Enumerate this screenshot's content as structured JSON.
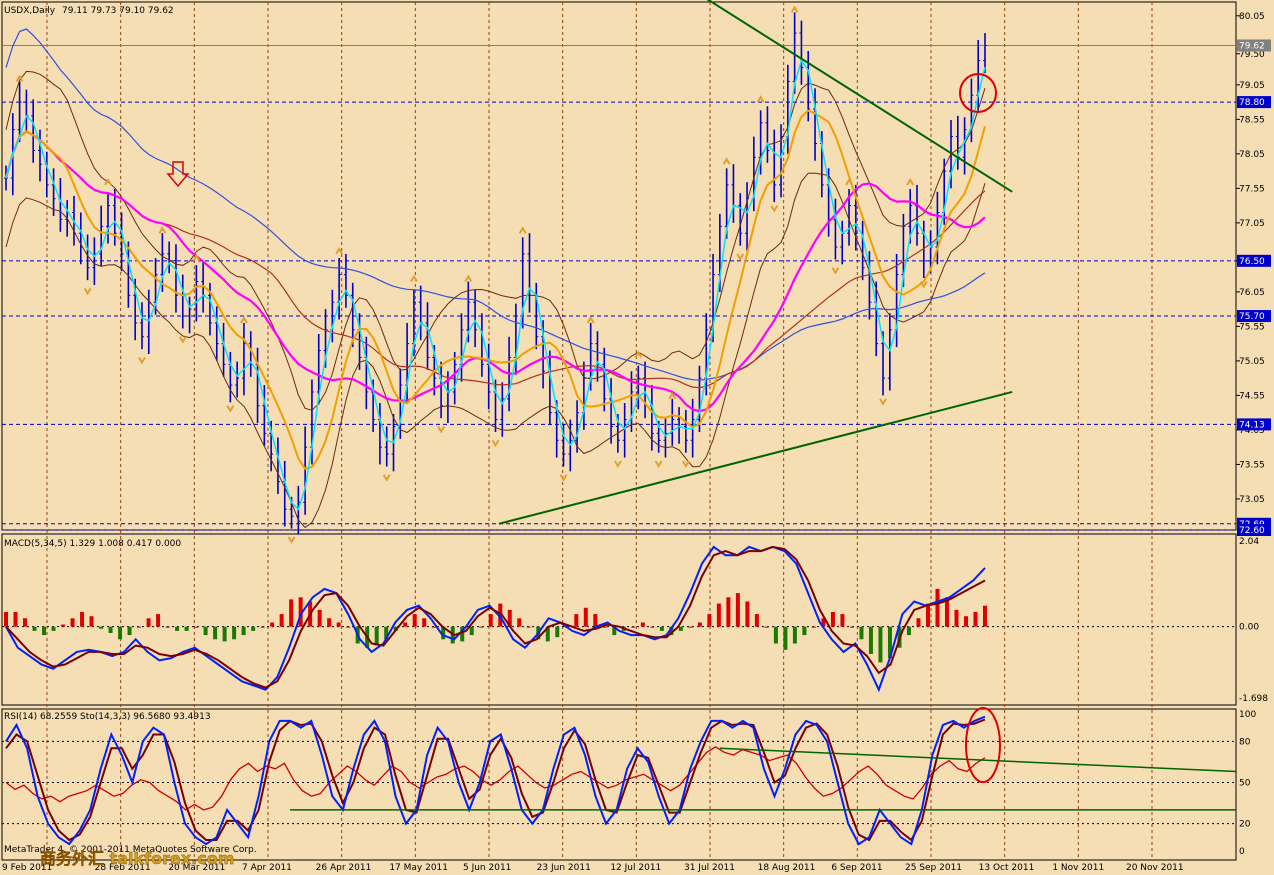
{
  "header": {
    "symbol_label": "USDX,Daily",
    "ohlc_text": "79.11 79.73 79.10 79.62"
  },
  "macd_header": {
    "text": "MACD(5,34,5) 1.329 1.008 0.417 0.000"
  },
  "rsi_header": {
    "text": "RSI(14) 68.2559  Sto(14,3,3) 96.5680 93.4913"
  },
  "footer": {
    "copyright": "MetaTrader 4, © 2001-2011 MetaQuotes Software Corp.",
    "watermark": "商务外汇 talkforex.com"
  },
  "colors": {
    "background": "#F5DEB3",
    "grid": "#8B4513",
    "price_bar": "#0000CD",
    "trendline": "#006400",
    "ma_magenta": "#FF00FF",
    "ma_orange": "#F0A000",
    "ma_blue": "#3050E0",
    "ma_darkred": "#B03020",
    "ma_cyan": "#00E5FF",
    "band": "#6B2A10",
    "level_line": "#0000CD",
    "macd_pos": "#E00000",
    "macd_neg": "#1A7A00",
    "macd_line": "#0020FF",
    "signal_line": "#7A0000",
    "rsi_line": "#D00000",
    "stoch_main": "#0020FF",
    "stoch_signal": "#7A0000",
    "circle": "#E00000",
    "arrow": "#E00000",
    "fractal": "#E0A030"
  },
  "chart_data": [
    {
      "type": "line",
      "title": "USDX,Daily",
      "subtitle": "79.11 79.73 79.10 79.62",
      "x_axis": [
        "9 Feb 2011",
        "28 Feb 2011",
        "20 Mar 2011",
        "7 Apr 2011",
        "26 Apr 2011",
        "17 May 2011",
        "5 Jun 2011",
        "23 Jun 2011",
        "12 Jul 2011",
        "31 Jul 2011",
        "18 Aug 2011",
        "6 Sep 2011",
        "25 Sep 2011",
        "13 Oct 2011",
        "1 Nov 2011",
        "20 Nov 2011"
      ],
      "y_ticks": [
        "80.05",
        "79.50",
        "79.05",
        "78.55",
        "78.05",
        "77.55",
        "77.05",
        "76.50",
        "76.05",
        "75.55",
        "75.05",
        "74.55",
        "74.05",
        "73.55",
        "73.05"
      ],
      "ylim": [
        72.6,
        80.25
      ],
      "price_labels": [
        "79.62",
        "78.80",
        "76.50",
        "75.70",
        "74.13",
        "72.69",
        "72.60"
      ],
      "horizontal_levels": [
        78.8,
        76.5,
        75.7,
        74.13,
        72.69,
        72.6
      ],
      "series": [
        {
          "style": "bars",
          "values": [
            77.7,
            78.4,
            78.8,
            78.6,
            78.1,
            77.9,
            77.6,
            77.4,
            77.1,
            77.2,
            76.9,
            76.7,
            76.4,
            76.6,
            77.0,
            77.3,
            76.9,
            76.6,
            76.0,
            75.6,
            75.4,
            75.9,
            76.3,
            76.6,
            76.5,
            76.0,
            75.7,
            75.8,
            76.2,
            76.0,
            75.6,
            75.3,
            75.0,
            74.7,
            74.8,
            75.3,
            75.0,
            74.4,
            74.0,
            73.7,
            73.3,
            72.9,
            72.8,
            73.0,
            73.8,
            74.6,
            75.2,
            75.5,
            75.9,
            76.3,
            76.0,
            75.5,
            75.1,
            74.6,
            74.2,
            73.8,
            73.7,
            74.1,
            74.7,
            75.3,
            75.9,
            75.6,
            75.1,
            74.8,
            74.4,
            74.6,
            75.0,
            75.5,
            75.9,
            75.5,
            75.0,
            74.6,
            74.2,
            74.5,
            75.1,
            75.7,
            76.6,
            76.0,
            75.4,
            74.9,
            74.3,
            73.9,
            73.7,
            73.9,
            74.3,
            74.8,
            75.3,
            75.0,
            74.5,
            74.1,
            73.9,
            74.2,
            74.6,
            74.8,
            74.4,
            74.0,
            73.9,
            74.0,
            74.2,
            74.1,
            73.9,
            74.2,
            74.8,
            75.5,
            76.3,
            77.0,
            77.6,
            77.3,
            76.9,
            77.4,
            78.0,
            78.5,
            78.1,
            77.6,
            78.3,
            79.1,
            79.8,
            79.3,
            78.7,
            78.2,
            77.6,
            77.1,
            76.7,
            76.9,
            77.3,
            76.9,
            76.4,
            75.9,
            75.3,
            74.8,
            75.5,
            76.3,
            77.0,
            77.3,
            76.9,
            76.5,
            76.7,
            77.2,
            77.8,
            78.3,
            78.0,
            78.4,
            78.9,
            79.4,
            79.62
          ]
        },
        {
          "style": "channel",
          "name": "",
          "start": [
            72.5,
            72.69
          ],
          "end": [
            148,
            74.6
          ]
        },
        {
          "style": "channel",
          "name": "",
          "start": [
            103,
            80.3
          ],
          "end": [
            148,
            77.5
          ]
        }
      ]
    },
    {
      "type": "bar",
      "title": "MACD(5,34,5) 1.329 1.008 0.417 0.000",
      "y_ticks": [
        "2.04",
        "0.00",
        "-1.698"
      ],
      "ylim": [
        -1.698,
        2.04
      ],
      "series": [
        {
          "name": "histogram",
          "values": [
            0.35,
            0.35,
            0.2,
            -0.1,
            -0.2,
            -0.1,
            0.05,
            0.2,
            0.35,
            0.25,
            -0.05,
            -0.15,
            -0.3,
            -0.2,
            0.0,
            0.2,
            0.3,
            0.0,
            -0.1,
            -0.1,
            0.0,
            -0.2,
            -0.3,
            -0.35,
            -0.3,
            -0.2,
            -0.1,
            0.0,
            0.1,
            0.3,
            0.65,
            0.7,
            0.6,
            0.4,
            0.2,
            0.1,
            0.0,
            -0.4,
            -0.5,
            -0.45,
            -0.3,
            -0.1,
            0.1,
            0.3,
            0.2,
            0.0,
            -0.3,
            -0.4,
            -0.35,
            -0.2,
            0.0,
            0.3,
            0.55,
            0.4,
            0.2,
            0.0,
            -0.3,
            -0.35,
            -0.25,
            0.0,
            0.3,
            0.45,
            0.3,
            0.0,
            -0.2,
            -0.1,
            0.0,
            0.1,
            0.0,
            -0.1,
            -0.2,
            -0.1,
            0.0,
            0.1,
            0.3,
            0.55,
            0.7,
            0.8,
            0.6,
            0.3,
            0.0,
            -0.4,
            -0.55,
            -0.4,
            -0.2,
            0.0,
            0.2,
            0.35,
            0.3,
            0.0,
            -0.3,
            -0.65,
            -0.85,
            -0.75,
            -0.5,
            -0.2,
            0.2,
            0.55,
            0.9,
            0.7,
            0.4,
            0.25,
            0.35,
            0.5
          ]
        },
        {
          "name": "macd",
          "values": [
            0.0,
            -0.5,
            -0.7,
            -0.9,
            -1.0,
            -0.8,
            -0.6,
            -0.55,
            -0.6,
            -0.7,
            -0.6,
            -0.3,
            -0.6,
            -0.8,
            -0.75,
            -0.6,
            -0.5,
            -0.7,
            -0.9,
            -1.1,
            -1.3,
            -1.4,
            -1.5,
            -1.2,
            -0.5,
            0.3,
            0.7,
            0.9,
            0.8,
            0.3,
            -0.3,
            -0.6,
            -0.4,
            0.1,
            0.4,
            0.5,
            0.2,
            -0.2,
            -0.3,
            0.0,
            0.4,
            0.5,
            0.2,
            -0.3,
            -0.5,
            -0.2,
            0.2,
            0.1,
            -0.1,
            -0.2,
            0.0,
            0.1,
            -0.1,
            -0.2,
            -0.2,
            -0.3,
            -0.2,
            0.2,
            0.8,
            1.5,
            1.9,
            1.7,
            1.7,
            1.9,
            1.8,
            1.9,
            1.8,
            1.5,
            0.8,
            0.1,
            -0.3,
            -0.6,
            -0.4,
            -0.9,
            -1.5,
            -0.7,
            0.3,
            0.6,
            0.5,
            0.6,
            0.7,
            0.9,
            1.1,
            1.4
          ]
        },
        {
          "name": "signal",
          "values": [
            0.0,
            -0.3,
            -0.6,
            -0.8,
            -0.95,
            -0.9,
            -0.75,
            -0.6,
            -0.6,
            -0.65,
            -0.65,
            -0.45,
            -0.5,
            -0.65,
            -0.7,
            -0.65,
            -0.55,
            -0.65,
            -0.8,
            -1.0,
            -1.2,
            -1.35,
            -1.45,
            -1.3,
            -0.8,
            -0.1,
            0.4,
            0.75,
            0.8,
            0.5,
            0.0,
            -0.4,
            -0.45,
            -0.1,
            0.25,
            0.45,
            0.3,
            0.0,
            -0.2,
            -0.1,
            0.25,
            0.45,
            0.3,
            -0.1,
            -0.4,
            -0.3,
            0.0,
            0.1,
            0.0,
            -0.1,
            -0.05,
            0.05,
            0.0,
            -0.1,
            -0.2,
            -0.25,
            -0.25,
            0.0,
            0.5,
            1.2,
            1.7,
            1.8,
            1.7,
            1.8,
            1.8,
            1.9,
            1.85,
            1.6,
            1.1,
            0.4,
            -0.1,
            -0.4,
            -0.45,
            -0.7,
            -1.1,
            -0.9,
            -0.1,
            0.4,
            0.5,
            0.55,
            0.65,
            0.8,
            0.95,
            1.1
          ]
        }
      ]
    },
    {
      "type": "line",
      "title": "RSI(14) 68.2559  Sto(14,3,3) 96.5680 93.4913",
      "y_ticks": [
        "100",
        "80",
        "50",
        "20",
        "0"
      ],
      "ylim": [
        0,
        100
      ],
      "levels": [
        80,
        50,
        20
      ],
      "series": [
        {
          "name": "rsi",
          "values": [
            50,
            45,
            48,
            42,
            38,
            40,
            36,
            40,
            42,
            44,
            48,
            44,
            40,
            42,
            48,
            52,
            50,
            44,
            40,
            36,
            30,
            34,
            30,
            32,
            40,
            52,
            60,
            64,
            58,
            62,
            60,
            64,
            52,
            44,
            40,
            42,
            50,
            56,
            62,
            58,
            52,
            48,
            55,
            62,
            58,
            50,
            46,
            50,
            54,
            56,
            60,
            62,
            58,
            52,
            48,
            52,
            58,
            62,
            56,
            50,
            46,
            48,
            52,
            56,
            58,
            54,
            50,
            46,
            48,
            52,
            54,
            56,
            52,
            48,
            44,
            48,
            56,
            64,
            72,
            76,
            72,
            70,
            74,
            72,
            70,
            66,
            68,
            70,
            64,
            54,
            46,
            40,
            42,
            46,
            52,
            58,
            62,
            56,
            48,
            44,
            40,
            38,
            46,
            56,
            62,
            66,
            60,
            58,
            64,
            68
          ]
        },
        {
          "name": "stoch_main",
          "values": [
            80,
            92,
            75,
            40,
            20,
            10,
            5,
            15,
            30,
            60,
            85,
            70,
            50,
            80,
            90,
            85,
            50,
            20,
            10,
            5,
            10,
            30,
            20,
            10,
            40,
            80,
            95,
            95,
            90,
            95,
            70,
            40,
            30,
            60,
            85,
            95,
            80,
            40,
            20,
            30,
            70,
            90,
            80,
            50,
            30,
            50,
            80,
            85,
            60,
            30,
            20,
            30,
            60,
            85,
            90,
            70,
            40,
            20,
            30,
            60,
            75,
            65,
            40,
            20,
            30,
            60,
            80,
            95,
            95,
            90,
            95,
            90,
            60,
            40,
            60,
            85,
            95,
            92,
            80,
            50,
            20,
            5,
            10,
            30,
            20,
            10,
            5,
            30,
            70,
            92,
            95,
            90,
            95,
            98
          ]
        },
        {
          "name": "stoch_signal",
          "values": [
            75,
            85,
            80,
            55,
            30,
            15,
            8,
            12,
            25,
            50,
            75,
            75,
            60,
            70,
            85,
            85,
            65,
            35,
            15,
            8,
            8,
            22,
            22,
            15,
            30,
            65,
            88,
            95,
            92,
            93,
            80,
            55,
            35,
            50,
            75,
            90,
            85,
            55,
            30,
            28,
            55,
            82,
            82,
            60,
            38,
            45,
            70,
            82,
            68,
            42,
            25,
            28,
            50,
            75,
            88,
            78,
            52,
            30,
            28,
            50,
            70,
            68,
            48,
            28,
            28,
            50,
            72,
            90,
            95,
            92,
            93,
            92,
            72,
            50,
            55,
            75,
            90,
            93,
            85,
            62,
            32,
            12,
            8,
            22,
            22,
            14,
            8,
            22,
            55,
            85,
            93,
            92,
            93,
            96
          ]
        },
        {
          "name": "",
          "style": "trendline",
          "start_value": 30,
          "end_value": 30
        },
        {
          "name": "",
          "style": "trendline",
          "start_value": 75,
          "end_value": 58
        }
      ]
    }
  ]
}
